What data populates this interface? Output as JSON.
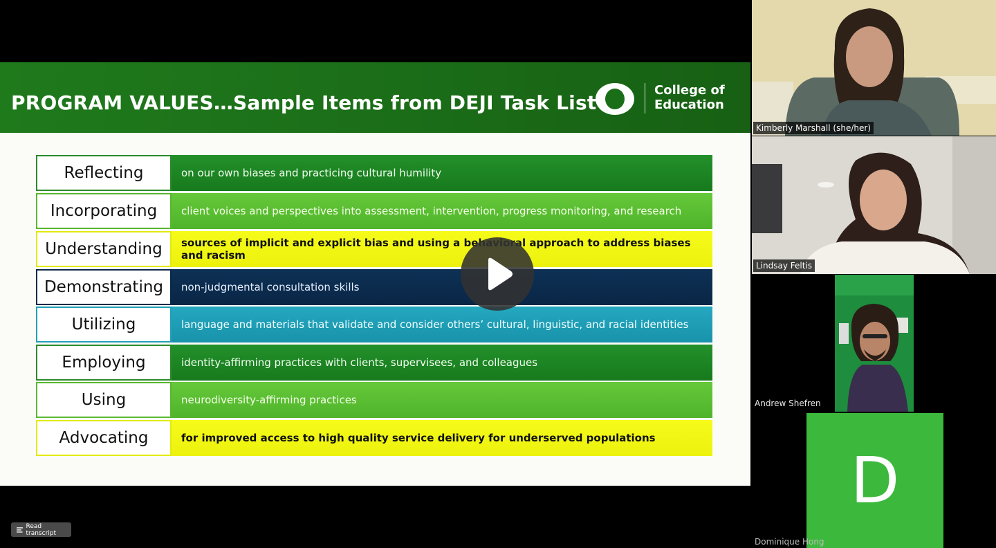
{
  "slide": {
    "title": "PROGRAM VALUES…Sample Items from DEJI Task List",
    "logo_text_line1": "College of",
    "logo_text_line2": "Education",
    "rows": [
      {
        "verb": "Reflecting",
        "text": "on our own biases and practicing cultural humility",
        "color": "#1b7f1f"
      },
      {
        "verb": "Incorporating",
        "text": "client voices and perspectives into assessment, intervention, progress monitoring, and research",
        "color": "#57b92f"
      },
      {
        "verb": "Understanding",
        "text": "sources of implicit and explicit bias and using a behavioral approach to address biases and racism",
        "color": "#eef414"
      },
      {
        "verb": "Demonstrating",
        "text": "non-judgmental consultation skills",
        "color": "#0b2a4b"
      },
      {
        "verb": "Utilizing",
        "text": "language and materials that validate and consider others’ cultural, linguistic, and racial identities",
        "color": "#1f9fb6"
      },
      {
        "verb": "Employing",
        "text": "identity-affirming practices with clients, supervisees, and colleagues",
        "color": "#1b7f1f"
      },
      {
        "verb": "Using",
        "text": "neurodiversity-affirming practices",
        "color": "#57b92f"
      },
      {
        "verb": "Advocating",
        "text": "for improved access to high quality service delivery for underserved populations",
        "color": "#eef414"
      }
    ]
  },
  "participants": [
    {
      "name": "Kimberly Marshall (she/her)"
    },
    {
      "name": "Lindsay Feltis"
    },
    {
      "name": "Andrew Shefren"
    },
    {
      "name": "Dominique Hong",
      "avatar_letter": "D"
    }
  ],
  "controls": {
    "transcript_label": "Read transcript"
  },
  "icons": {
    "play": "play-icon",
    "transcript": "transcript-icon"
  }
}
